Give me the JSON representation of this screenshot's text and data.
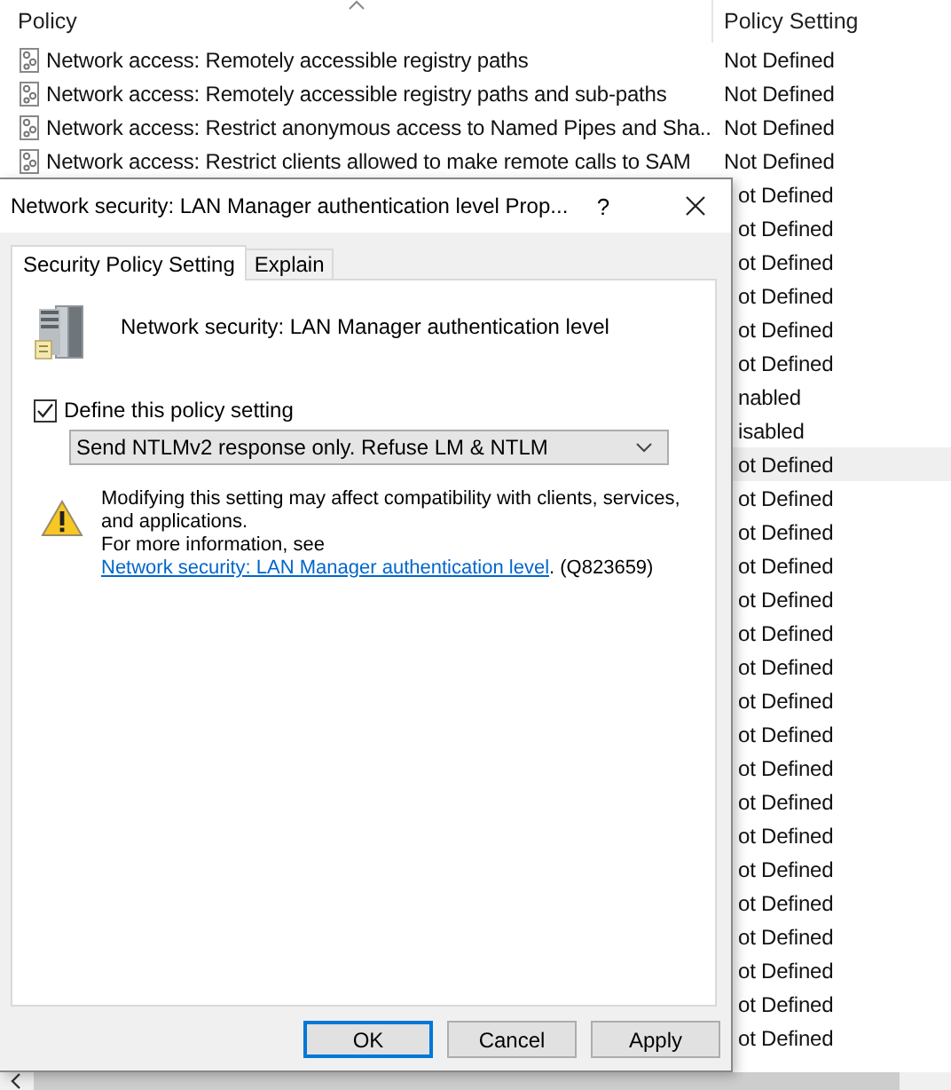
{
  "list": {
    "columns": [
      {
        "label": "Policy",
        "sorted": true
      },
      {
        "label": "Policy Setting",
        "sorted": false
      }
    ],
    "rows": [
      {
        "policy": "Network access: Remotely accessible registry paths",
        "setting": "Not Defined",
        "selected": false
      },
      {
        "policy": "Network access: Remotely accessible registry paths and sub-paths",
        "setting": "Not Defined",
        "selected": false
      },
      {
        "policy": "Network access: Restrict anonymous access to Named Pipes and Sha...",
        "setting": "Not Defined",
        "selected": false
      },
      {
        "policy": "Network access: Restrict clients allowed to make remote calls to SAM",
        "setting": "Not Defined",
        "selected": false
      },
      {
        "setting": "ot Defined",
        "selected": false
      },
      {
        "setting": "ot Defined",
        "selected": false
      },
      {
        "setting": "ot Defined",
        "selected": false
      },
      {
        "setting": "ot Defined",
        "selected": false
      },
      {
        "setting": "ot Defined",
        "selected": false
      },
      {
        "setting": "ot Defined",
        "selected": false
      },
      {
        "setting": "nabled",
        "selected": false
      },
      {
        "setting": "isabled",
        "selected": false
      },
      {
        "setting": "ot Defined",
        "selected": true
      },
      {
        "setting": "ot Defined",
        "selected": false
      },
      {
        "setting": "ot Defined",
        "selected": false
      },
      {
        "setting": "ot Defined",
        "selected": false
      },
      {
        "setting": "ot Defined",
        "selected": false
      },
      {
        "setting": "ot Defined",
        "selected": false
      },
      {
        "setting": "ot Defined",
        "selected": false
      },
      {
        "setting": "ot Defined",
        "selected": false
      },
      {
        "setting": "ot Defined",
        "selected": false
      },
      {
        "setting": "ot Defined",
        "selected": false
      },
      {
        "setting": "ot Defined",
        "selected": false
      },
      {
        "setting": "ot Defined",
        "selected": false
      },
      {
        "setting": "ot Defined",
        "selected": false
      },
      {
        "setting": "ot Defined",
        "selected": false
      },
      {
        "setting": "ot Defined",
        "selected": false
      },
      {
        "setting": "ot Defined",
        "selected": false
      },
      {
        "setting": "ot Defined",
        "selected": false
      },
      {
        "setting": "ot Defined",
        "selected": false
      }
    ]
  },
  "dialog": {
    "title": "Network security: LAN Manager authentication level Prop...",
    "help": "?",
    "tabs": [
      {
        "label": "Security Policy Setting",
        "selected": true
      },
      {
        "label": "Explain",
        "selected": false
      }
    ],
    "heading": "Network security: LAN Manager authentication level",
    "checkbox": {
      "label": "Define this policy setting",
      "checked": true
    },
    "dropdown": {
      "value": "Send NTLMv2 response only. Refuse LM & NTLM"
    },
    "warning": {
      "text": "Modifying this setting may affect compatibility with clients, services, and applications.",
      "more_prefix": "For more information, see ",
      "link": "Network security: LAN Manager authentication level",
      "more_suffix": ". (Q823659)"
    },
    "buttons": [
      {
        "label": "OK",
        "default": true
      },
      {
        "label": "Cancel",
        "default": false
      },
      {
        "label": "Apply",
        "default": false
      }
    ]
  }
}
